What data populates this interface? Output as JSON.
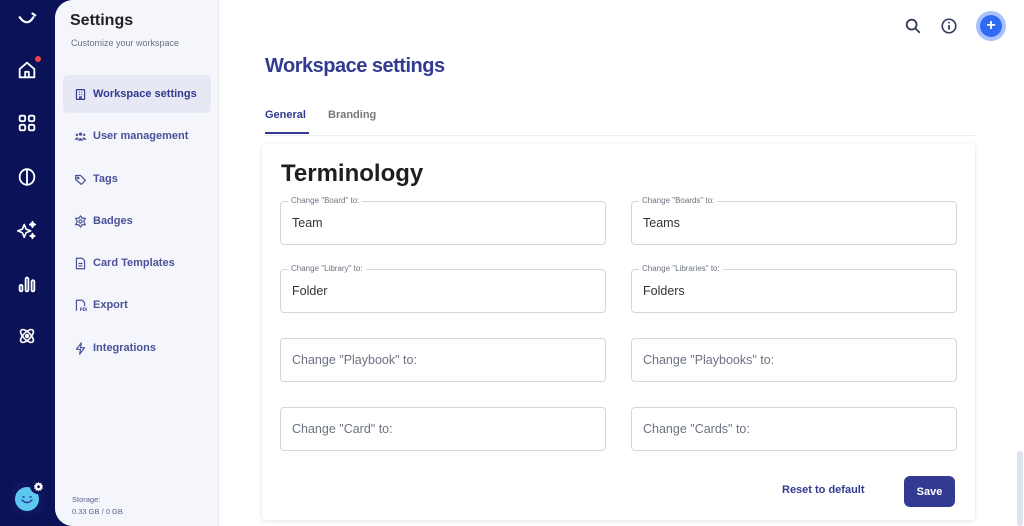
{
  "rail": {
    "items": [
      {
        "name": "logo",
        "icon": "smile-logo-icon"
      },
      {
        "name": "home",
        "icon": "home-icon",
        "notification": true
      },
      {
        "name": "apps",
        "icon": "grid-icon"
      },
      {
        "name": "brain",
        "icon": "brain-icon"
      },
      {
        "name": "ai",
        "icon": "sparkles-icon"
      },
      {
        "name": "analytics",
        "icon": "bar-chart-icon"
      },
      {
        "name": "integrations",
        "icon": "atom-icon"
      }
    ],
    "notification_color": "#ef4444"
  },
  "sidebar": {
    "title": "Settings",
    "subtitle": "Customize your workspace",
    "items": [
      {
        "label": "Workspace settings",
        "icon": "building-icon",
        "active": true
      },
      {
        "label": "User management",
        "icon": "users-icon",
        "active": false
      },
      {
        "label": "Tags",
        "icon": "tag-icon",
        "active": false
      },
      {
        "label": "Badges",
        "icon": "badge-icon",
        "active": false
      },
      {
        "label": "Card Templates",
        "icon": "document-icon",
        "active": false
      },
      {
        "label": "Export",
        "icon": "pdf-icon",
        "active": false
      },
      {
        "label": "Integrations",
        "icon": "lightning-icon",
        "active": false
      }
    ],
    "storage_label": "Storage:",
    "storage_value": "0.33 GB / 0 GB"
  },
  "header": {
    "search_icon": "search-icon",
    "info_icon": "info-icon",
    "add_icon": "plus-icon"
  },
  "page": {
    "title": "Workspace settings",
    "tabs": [
      {
        "label": "General",
        "active": true
      },
      {
        "label": "Branding",
        "active": false
      }
    ]
  },
  "terminology": {
    "title": "Terminology",
    "fields": [
      {
        "label": "Change \"Board\" to:",
        "value": "Team"
      },
      {
        "label": "Change \"Boards\" to:",
        "value": "Teams"
      },
      {
        "label": "Change \"Library\" to:",
        "value": "Folder"
      },
      {
        "label": "Change \"Libraries\" to:",
        "value": "Folders"
      },
      {
        "label": "Change \"Playbook\" to:",
        "value": ""
      },
      {
        "label": "Change \"Playbooks\" to:",
        "value": ""
      },
      {
        "label": "Change \"Card\" to:",
        "value": ""
      },
      {
        "label": "Change \"Cards\" to:",
        "value": ""
      }
    ],
    "reset_label": "Reset to default",
    "save_label": "Save"
  },
  "colors": {
    "rail_bg": "#0b1257",
    "primary": "#323a91",
    "accent_blue": "#2f6bf2"
  }
}
